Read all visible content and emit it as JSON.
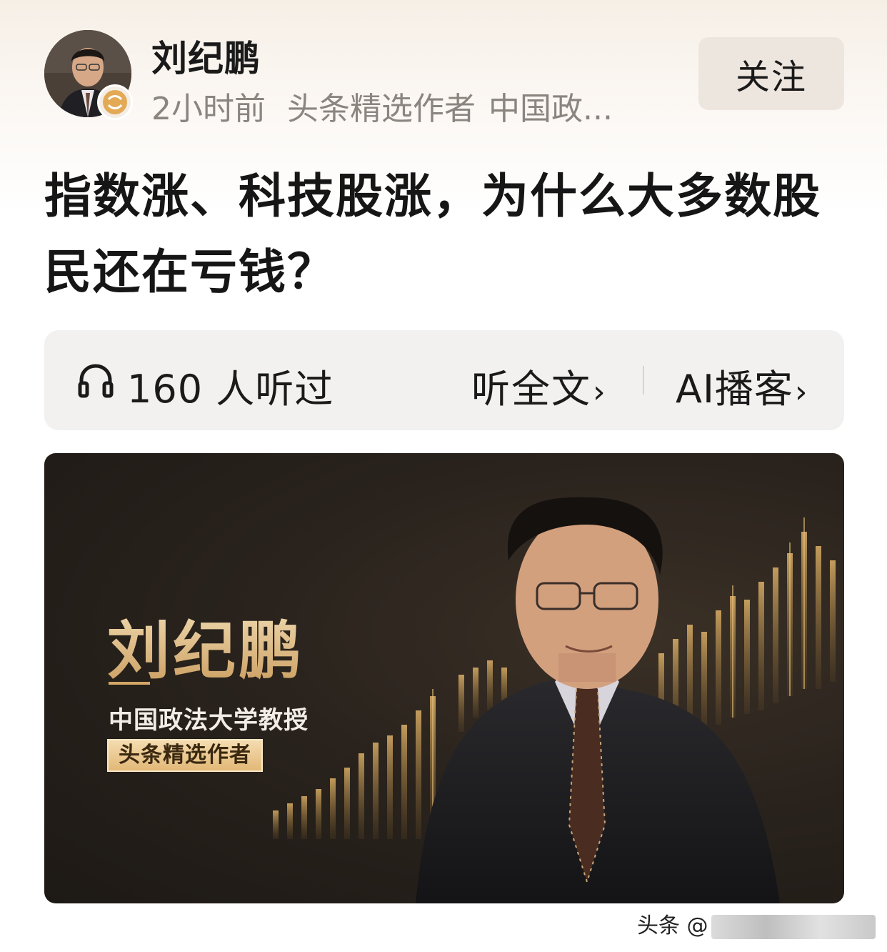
{
  "header": {
    "author_name": "刘纪鹏",
    "meta": {
      "time": "2小时前",
      "tag": "头条精选作者",
      "affiliation_truncated": "中国政..."
    },
    "follow_label": "关注",
    "avatar_icon": "avatar-photo",
    "verify_icon": "verified-badge-icon"
  },
  "article": {
    "title": "指数涨、科技股涨，为什么大多数股民还在亏钱？"
  },
  "listen_bar": {
    "icon": "headphones-icon",
    "count_text": "160 人听过",
    "full_text_label": "听全文",
    "ai_podcast_label": "AI播客",
    "chevron": "›"
  },
  "cover": {
    "name": "刘纪鹏",
    "affiliation": "中国政法大学教授",
    "badge": "头条精选作者",
    "accent_color": "#d4a766"
  },
  "watermark": {
    "prefix": "头条 @"
  },
  "colors": {
    "meta_gray": "#8b857f",
    "follow_bg": "#ede6de",
    "listen_bar_bg": "#f2f1f0"
  }
}
